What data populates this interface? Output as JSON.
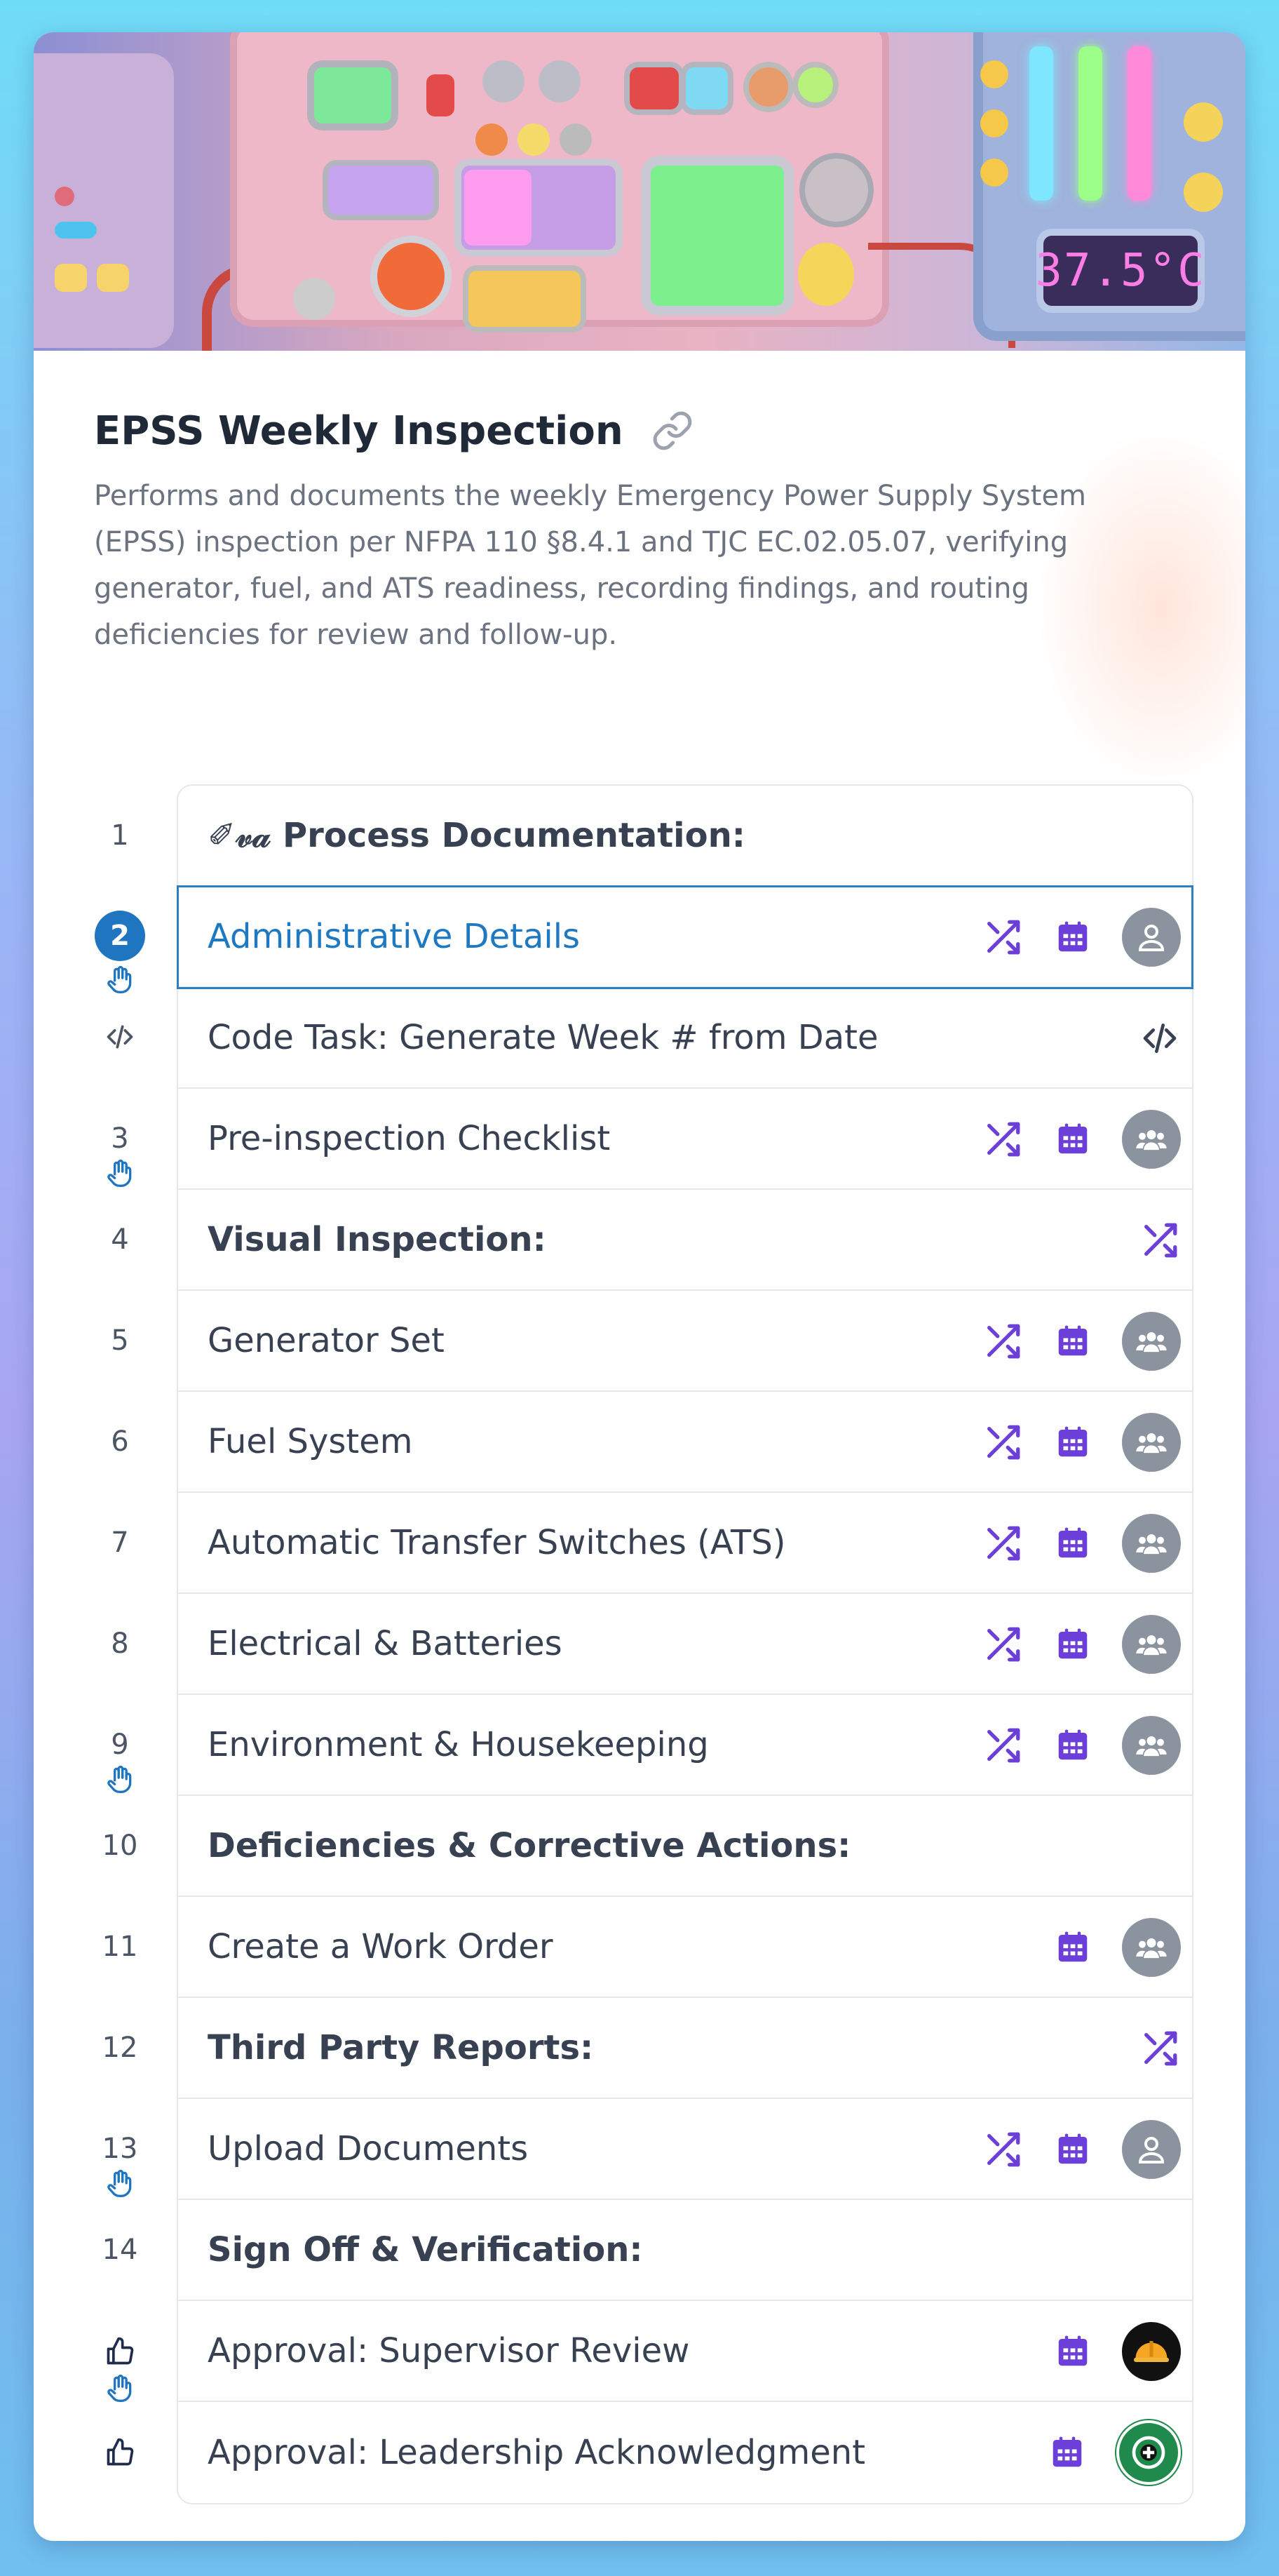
{
  "banner": {
    "display_reading": "37.5°C"
  },
  "header": {
    "title": "EPSS Weekly Inspection",
    "description": "Performs and documents the weekly Emergency Power Supply System (EPSS) inspection per NFPA 110 §8.4.1 and TJC EC.02.05.07, verifying generator, fuel, and ATS readiness, recording findings, and routing deficiencies for review and follow-up."
  },
  "colors": {
    "accent": "#6d3fd9",
    "active": "#1e78c2",
    "avatar_gray": "#8b949e"
  },
  "steps": [
    {
      "number": "1",
      "label": "✐𝓋𝒶 Process Documentation:",
      "bold": true,
      "icons": []
    },
    {
      "number": "2",
      "label": "Administrative Details",
      "bold": false,
      "active": true,
      "hand": true,
      "icons": [
        "shuffle-icon",
        "calendar-icon",
        "user-avatar"
      ]
    },
    {
      "number": "</>",
      "label": "Code Task: Generate Week # from Date",
      "bold": false,
      "icons": [
        "code-icon"
      ]
    },
    {
      "number": "3",
      "label": "Pre-inspection Checklist",
      "bold": false,
      "hand": true,
      "icons": [
        "shuffle-icon",
        "calendar-icon",
        "group-avatar"
      ]
    },
    {
      "number": "4",
      "label": "Visual Inspection:",
      "bold": true,
      "icons": [
        "shuffle-icon"
      ]
    },
    {
      "number": "5",
      "label": "Generator Set",
      "bold": false,
      "icons": [
        "shuffle-icon",
        "calendar-icon",
        "group-avatar"
      ]
    },
    {
      "number": "6",
      "label": "Fuel System",
      "bold": false,
      "icons": [
        "shuffle-icon",
        "calendar-icon",
        "group-avatar"
      ]
    },
    {
      "number": "7",
      "label": "Automatic Transfer Switches (ATS)",
      "bold": false,
      "icons": [
        "shuffle-icon",
        "calendar-icon",
        "group-avatar"
      ]
    },
    {
      "number": "8",
      "label": "Electrical & Batteries",
      "bold": false,
      "icons": [
        "shuffle-icon",
        "calendar-icon",
        "group-avatar"
      ]
    },
    {
      "number": "9",
      "label": "Environment & Housekeeping",
      "bold": false,
      "hand": true,
      "icons": [
        "shuffle-icon",
        "calendar-icon",
        "group-avatar"
      ]
    },
    {
      "number": "10",
      "label": "Deficiencies & Corrective Actions:",
      "bold": true,
      "icons": []
    },
    {
      "number": "11",
      "label": "Create a Work Order",
      "bold": false,
      "icons": [
        "calendar-icon",
        "group-avatar"
      ]
    },
    {
      "number": "12",
      "label": "Third Party Reports:",
      "bold": true,
      "icons": [
        "shuffle-icon"
      ]
    },
    {
      "number": "13",
      "label": "Upload Documents",
      "bold": false,
      "hand": true,
      "icons": [
        "shuffle-icon",
        "calendar-icon",
        "user-avatar"
      ]
    },
    {
      "number": "14",
      "label": "Sign Off & Verification:",
      "bold": true,
      "icons": []
    },
    {
      "number": "thumbs-up",
      "label": "Approval: Supervisor Review",
      "bold": false,
      "hand": true,
      "icons": [
        "calendar-icon",
        "hardhat-avatar"
      ]
    },
    {
      "number": "thumbs-up",
      "label": "Approval: Leadership Acknowledgment",
      "bold": false,
      "icons": [
        "calendar-icon",
        "committee-avatar"
      ]
    }
  ]
}
